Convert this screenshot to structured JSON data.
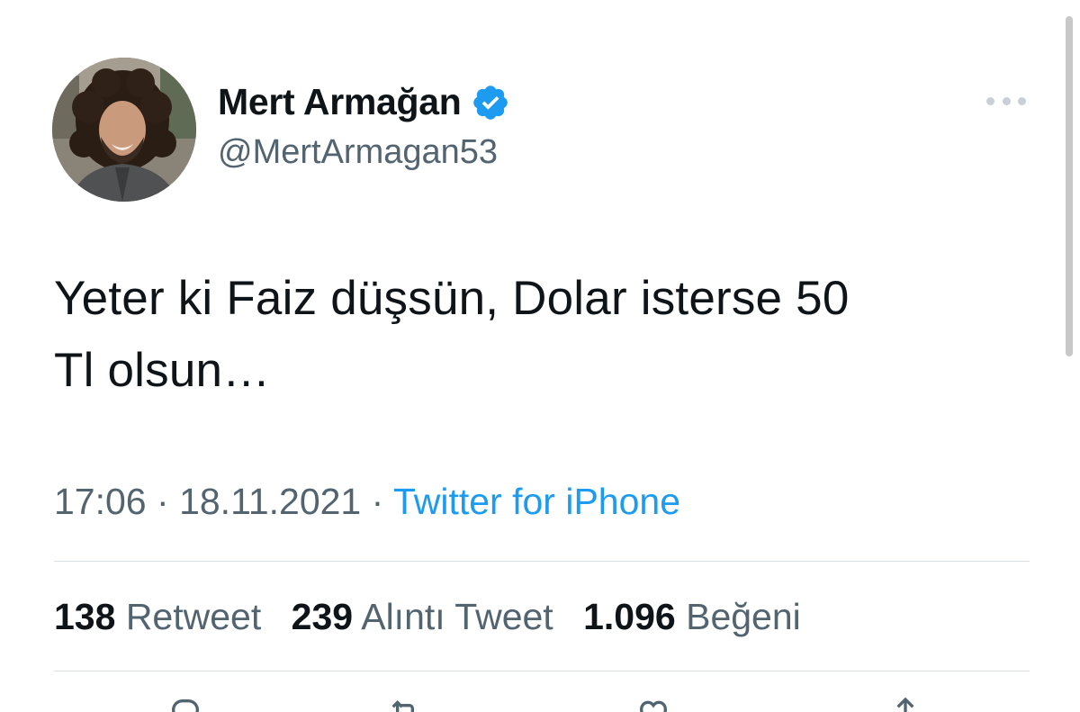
{
  "tweet": {
    "author": {
      "display_name": "Mert Armağan",
      "handle": "@MertArmagan53",
      "verified": true,
      "avatar_icon": "profile-photo"
    },
    "more_icon": "more-horizontal-icon",
    "text_line1": "Yeter ki Faiz düşsün, Dolar isterse 50",
    "text_line2": "Tl olsun…",
    "time": "17:06",
    "date": "18.11.2021",
    "separator": "·",
    "source": "Twitter for iPhone",
    "stats": {
      "retweets_count": "138",
      "retweets_label": "Retweet",
      "quotes_count": "239",
      "quotes_label": "Alıntı Tweet",
      "likes_count": "1.096",
      "likes_label": "Beğeni"
    },
    "actions": [
      "reply-icon",
      "retweet-icon",
      "like-icon",
      "share-icon"
    ]
  },
  "colors": {
    "text": "#0f1419",
    "secondary": "#536471",
    "link": "#1d9bf0",
    "verified": "#1d9bf0",
    "divider": "#d9dee2"
  }
}
